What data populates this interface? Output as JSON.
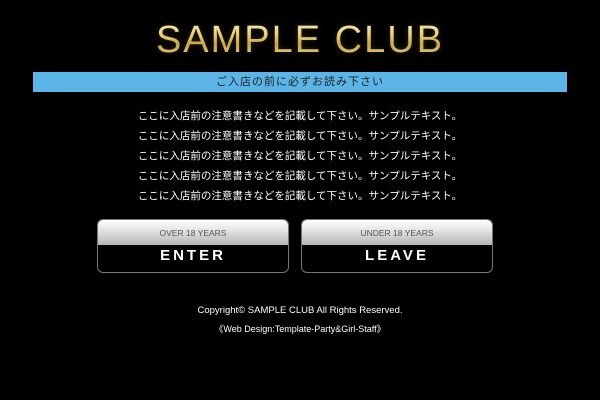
{
  "header": {
    "logo_text": "SAMPLE CLUB"
  },
  "notice": {
    "title": "ご入店の前に必ずお読み下さい",
    "lines": [
      "ここに入店前の注意書きなどを記載して下さい。サンプルテキスト。",
      "ここに入店前の注意書きなどを記載して下さい。サンプルテキスト。",
      "ここに入店前の注意書きなどを記載して下さい。サンプルテキスト。",
      "ここに入店前の注意書きなどを記載して下さい。サンプルテキスト。",
      "ここに入店前の注意書きなどを記載して下さい。サンプルテキスト。"
    ]
  },
  "buttons": {
    "enter": {
      "caption": "OVER 18 YEARS",
      "label": "ENTER"
    },
    "leave": {
      "caption": "UNDER 18 YEARS",
      "label": "LEAVE"
    }
  },
  "footer": {
    "copyright": "Copyright© SAMPLE CLUB All Rights Reserved.",
    "credit": "《Web Design:Template-Party&Girl-Staff》"
  },
  "colors": {
    "background": "#000000",
    "notice_bar": "#5bb5e6",
    "logo_gold": "#e8d089"
  }
}
